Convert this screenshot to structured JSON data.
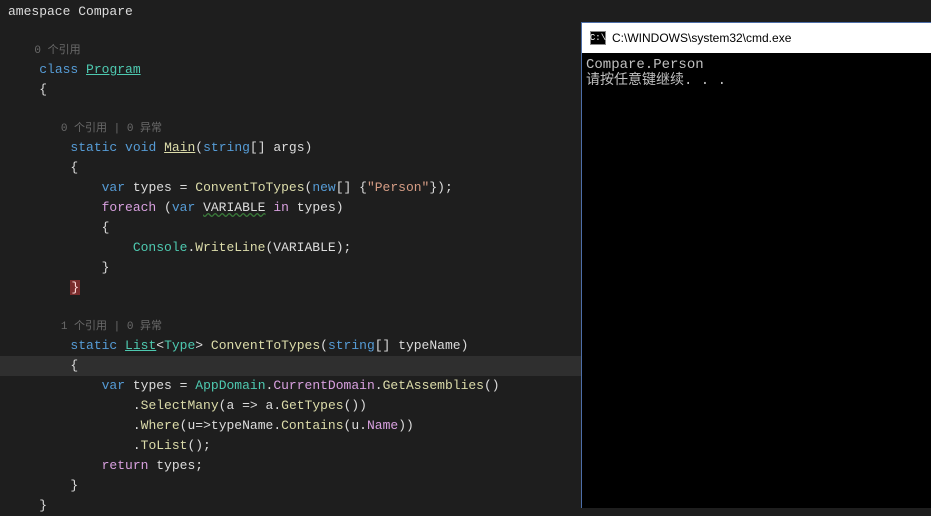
{
  "editor": {
    "topline": "amespace Compare",
    "codelens1": "0 个引用",
    "class_kw": "class",
    "class_name": "Program",
    "codelens2": "0 个引用 | 0 异常",
    "main_static": "static",
    "main_void": "void",
    "main_name": "Main",
    "main_params_type": "string",
    "main_params_name": "args",
    "var_kw": "var",
    "types_var": "types",
    "convent_call": "ConventToTypes",
    "new_kw": "new",
    "person_str": "\"Person\"",
    "foreach_kw": "foreach",
    "variable_name": "VARIABLE",
    "in_kw": "in",
    "types_ref": "types",
    "console": "Console",
    "writeline": "WriteLine",
    "variable_arg": "VARIABLE",
    "codelens3": "1 个引用 | 0 异常",
    "ct_static": "static",
    "ct_list": "List",
    "ct_type": "Type",
    "ct_name": "ConventToTypes",
    "ct_param_type": "string",
    "ct_param_name": "typeName",
    "appdomain": "AppDomain",
    "currentdomain": "CurrentDomain",
    "getassemblies": "GetAssemblies",
    "selectmany": "SelectMany",
    "lambda_a": "a",
    "gettypes": "GetTypes",
    "where": "Where",
    "lambda_u": "u",
    "contains": "Contains",
    "name_prop": "Name",
    "tolist": "ToList",
    "return_kw": "return",
    "types_ret": "types"
  },
  "cmd": {
    "title": "C:\\WINDOWS\\system32\\cmd.exe",
    "line1": "Compare.Person",
    "line2": "请按任意键继续. . ."
  }
}
